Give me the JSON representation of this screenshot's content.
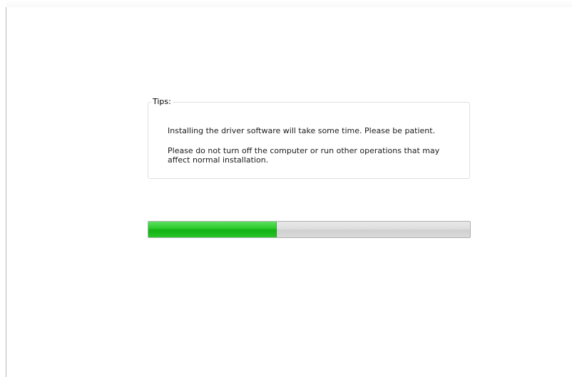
{
  "tips": {
    "legend": "Tips:",
    "line1": "Installing the driver software will take some time. Please be patient.",
    "line2": "Please do not turn off the computer or run other operations that may",
    "line3": "affect normal installation."
  },
  "progress": {
    "fraction": 0.4,
    "color": "#22c322"
  }
}
